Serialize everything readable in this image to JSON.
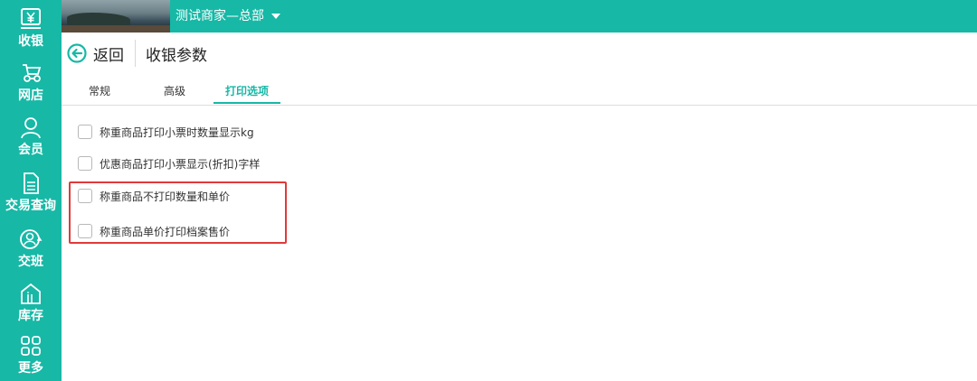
{
  "sidebar": {
    "items": [
      {
        "label": "收银",
        "icon": "yen-register-icon"
      },
      {
        "label": "网店",
        "icon": "online-store-icon"
      },
      {
        "label": "会员",
        "icon": "member-icon"
      },
      {
        "label": "交易查询",
        "icon": "document-icon"
      },
      {
        "label": "交班",
        "icon": "shift-handover-icon"
      },
      {
        "label": "库存",
        "icon": "warehouse-icon"
      },
      {
        "label": "更多",
        "icon": "grid-more-icon"
      }
    ]
  },
  "topbar": {
    "store_name": "测试商家—总部"
  },
  "header": {
    "back_label": "返回",
    "title": "收银参数"
  },
  "tabs": {
    "items": [
      {
        "label": "常规",
        "active": false
      },
      {
        "label": "高级",
        "active": false
      },
      {
        "label": "打印选项",
        "active": true
      }
    ]
  },
  "options": [
    {
      "label": "称重商品打印小票时数量显示kg",
      "checked": false
    },
    {
      "label": "优惠商品打印小票显示(折扣)字样",
      "checked": false
    },
    {
      "label": "称重商品不打印数量和单价",
      "checked": false
    },
    {
      "label": "称重商品单价打印档案售价",
      "checked": false
    }
  ],
  "colors": {
    "accent": "#17b8a6",
    "highlight_border": "#e03a3a"
  }
}
